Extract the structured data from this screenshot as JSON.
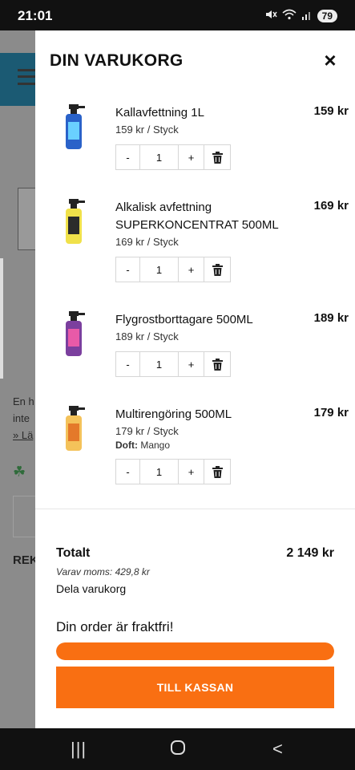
{
  "status": {
    "time": "21:01",
    "battery": "79",
    "mute_icon": "mute-icon",
    "wifi_icon": "wifi-icon",
    "signal_icon": "signal-icon"
  },
  "background": {
    "text1": "En h",
    "text2": "inte",
    "text3": "» Lä",
    "section": "REK"
  },
  "cart": {
    "title": "DIN VARUKORG",
    "close_label": "×",
    "items": [
      {
        "name": "Kallavfettning 1L",
        "line_price": "159 kr",
        "unit_price": "159 kr / Styck",
        "quantity": "1",
        "bottle_color": "#2a62c9",
        "label_color": "#6ad0ff"
      },
      {
        "name": "Alkalisk avfettning SUPERKONCENTRAT 500ML",
        "line_price": "169 kr",
        "unit_price": "169 kr / Styck",
        "quantity": "1",
        "bottle_color": "#f0e14a",
        "label_color": "#2b2b2b"
      },
      {
        "name": "Flygrostborttagare 500ML",
        "line_price": "189 kr",
        "unit_price": "189 kr / Styck",
        "quantity": "1",
        "bottle_color": "#7b3f9e",
        "label_color": "#e85aa8"
      },
      {
        "name": "Multirengöring 500ML",
        "line_price": "179 kr",
        "unit_price": "179 kr / Styck",
        "quantity": "1",
        "note_label": "Doft:",
        "note_value": "Mango",
        "bottle_color": "#f4c25a",
        "label_color": "#e4792a"
      }
    ],
    "qty_minus": "-",
    "qty_plus": "+",
    "total_label": "Totalt",
    "total_value": "2 149 kr",
    "moms": "Varav moms: 429,8 kr",
    "share": "Dela varukorg",
    "freeship": "Din order är fraktfri!",
    "progress_fraction": 1.0,
    "checkout_label": "TILL KASSAN",
    "accent_color": "#f96f12"
  },
  "nav": {
    "recent_label": "|||",
    "home_label": "○",
    "back_label": "<"
  }
}
